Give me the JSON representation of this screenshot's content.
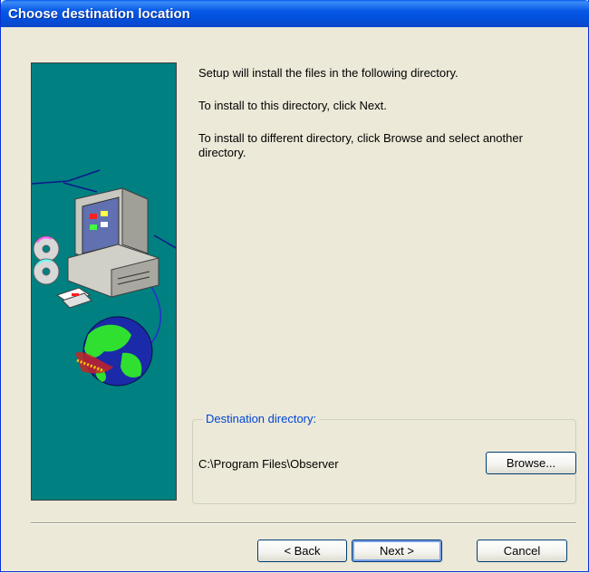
{
  "window": {
    "title": "Choose destination location"
  },
  "messages": {
    "line1": "Setup will install the files in the following directory.",
    "line2": "To install to this directory, click Next.",
    "line3": "To install to different directory, click Browse and select another directory."
  },
  "destination": {
    "legend": "Destination directory:",
    "path": "C:\\Program Files\\Observer",
    "browse_label": "Browse..."
  },
  "buttons": {
    "back": "< Back",
    "next": "Next >",
    "cancel": "Cancel"
  },
  "icons": {
    "side_image": "setup-illustration-computer-globe-icon"
  },
  "colors": {
    "title_bar": "#0758e6",
    "side_panel": "#008080",
    "dialog_bg": "#ece9d8",
    "legend_text": "#0046d5"
  }
}
